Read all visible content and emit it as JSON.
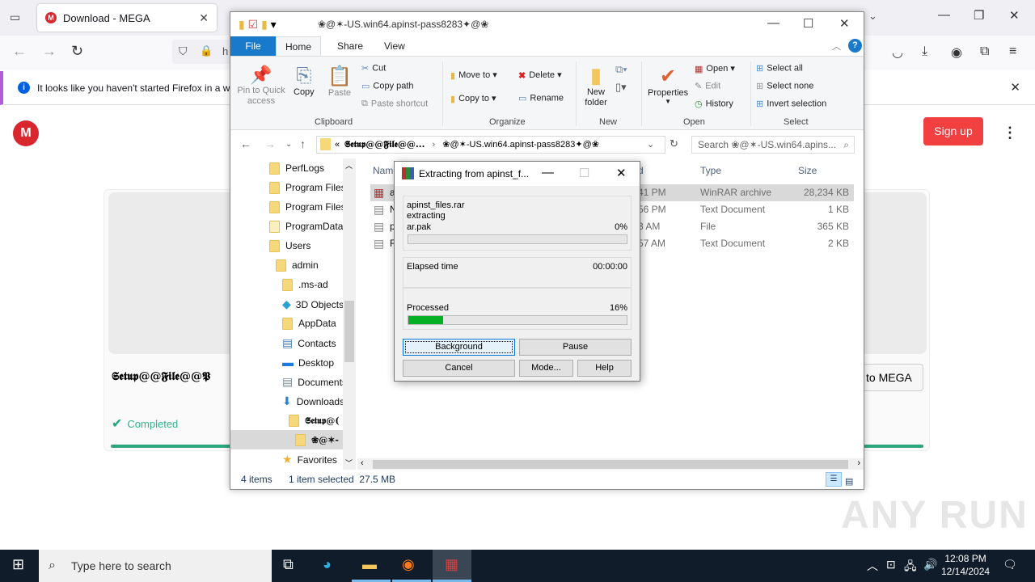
{
  "firefox": {
    "tab_title": "Download - MEGA",
    "tab_favicon": "M",
    "url_partial": "h",
    "notification": "It looks like you haven't started Firefox in a while",
    "icons": [
      "tab-list-icon",
      "back-icon",
      "forward-icon",
      "reload-icon",
      "shield-icon",
      "lock-icon",
      "pocket-icon",
      "download-icon",
      "account-icon",
      "extensions-icon",
      "menu-icon"
    ]
  },
  "mega": {
    "logo": "M",
    "signup_label": "Sign up",
    "file_name": "𝕾𝖊𝖙𝖚𝖕@@𝕱𝖎𝖑𝖊@@𝕻",
    "import_label": "to MEGA",
    "status": "Completed",
    "progress_percent": 100
  },
  "explorer": {
    "title": "❀@✶-US.win64.apinst-pass8283✦@❀",
    "ribbon_tabs": [
      "File",
      "Home",
      "Share",
      "View"
    ],
    "clipboard": {
      "pin": "Pin to Quick access",
      "copy": "Copy",
      "paste": "Paste",
      "cut": "Cut",
      "copy_path": "Copy path",
      "paste_shortcut": "Paste shortcut",
      "group": "Clipboard"
    },
    "organize": {
      "move_to": "Move to",
      "copy_to": "Copy to",
      "delete": "Delete",
      "rename": "Rename",
      "group": "Organize"
    },
    "new": {
      "new_folder": "New folder",
      "group": "New"
    },
    "open": {
      "properties": "Properties",
      "open": "Open",
      "edit": "Edit",
      "history": "History",
      "group": "Open"
    },
    "select": {
      "select_all": "Select all",
      "select_none": "Select none",
      "invert": "Invert selection",
      "group": "Select"
    },
    "breadcrumb": [
      "𝕾𝖊𝖙𝖚𝖕@@𝕱𝖎𝖑𝖊@@...",
      "❀@✶-US.win64.apinst-pass8283✦@❀"
    ],
    "search_placeholder": "Search ❀@✶-US.win64.apins...",
    "nav_items": [
      {
        "label": "PerfLogs"
      },
      {
        "label": "Program Files"
      },
      {
        "label": "Program Files"
      },
      {
        "label": "ProgramData"
      },
      {
        "label": "Users"
      },
      {
        "label": "admin"
      },
      {
        "label": ".ms-ad"
      },
      {
        "label": "3D Objects"
      },
      {
        "label": "AppData"
      },
      {
        "label": "Contacts"
      },
      {
        "label": "Desktop"
      },
      {
        "label": "Documents"
      },
      {
        "label": "Downloads"
      },
      {
        "label": "𝕾𝖊𝖙𝖚𝖕@("
      },
      {
        "label": "❀@✶-"
      },
      {
        "label": "Favorites"
      }
    ],
    "columns": [
      "Name",
      "d",
      "Type",
      "Size"
    ],
    "files": [
      {
        "name": "a",
        "date": "41 PM",
        "type": "WinRAR archive",
        "size": "28,234 KB",
        "selected": true
      },
      {
        "name": "N",
        "date": "56 PM",
        "type": "Text Document",
        "size": "1 KB",
        "selected": false
      },
      {
        "name": "p",
        "date": "3 AM",
        "type": "File",
        "size": "365 KB",
        "selected": false
      },
      {
        "name": "R",
        "date": "57 AM",
        "type": "Text Document",
        "size": "2 KB",
        "selected": false
      }
    ],
    "status_items": "4 items",
    "status_selected": "1 item selected  27.5 MB"
  },
  "winrar": {
    "title": "Extracting from apinst_f...",
    "archive": "apinst_files.rar",
    "action": "extracting",
    "current_file": "ar.pak",
    "file_percent_label": "0%",
    "file_progress": 0,
    "elapsed_label": "Elapsed time",
    "elapsed": "00:00:00",
    "processed_label": "Processed",
    "processed_percent_label": "16%",
    "processed_progress": 16,
    "buttons": {
      "background": "Background",
      "pause": "Pause",
      "cancel": "Cancel",
      "mode": "Mode...",
      "help": "Help"
    }
  },
  "taskbar": {
    "search_placeholder": "Type here to search",
    "time": "12:08 PM",
    "date": "12/14/2024"
  },
  "watermark": "ANY RUN"
}
